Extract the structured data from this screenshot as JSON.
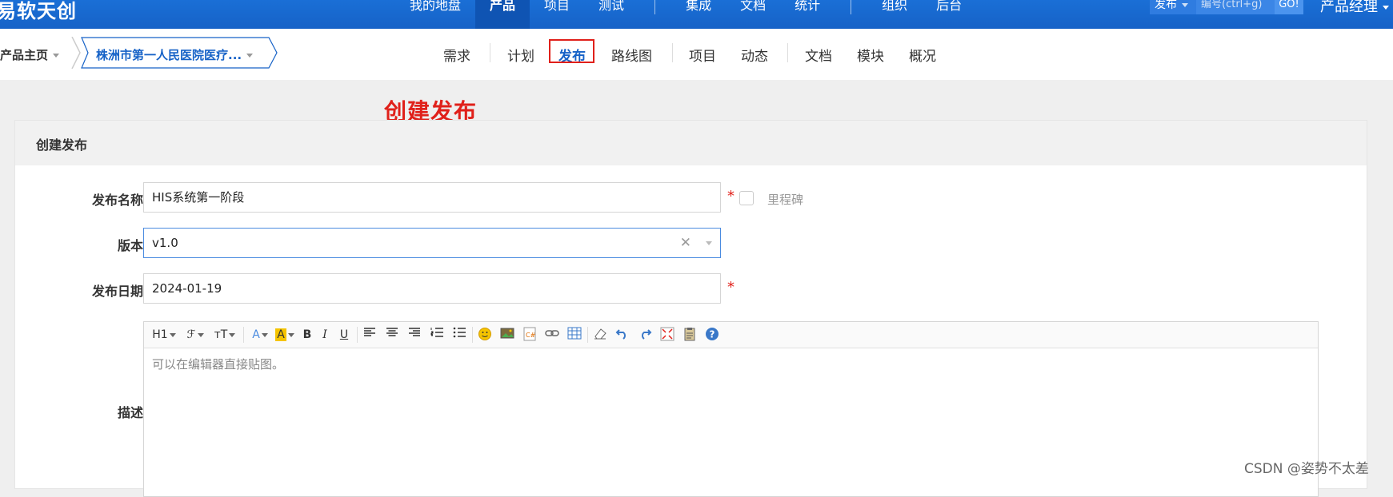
{
  "brand": "易软天创",
  "main_nav": [
    "我的地盘",
    "产品",
    "项目",
    "测试",
    "集成",
    "文档",
    "统计",
    "组织",
    "后台"
  ],
  "search": {
    "type_label": "发布",
    "placeholder": "编号(ctrl+g)",
    "go_label": "GO!"
  },
  "user_label": "产品经理",
  "breadcrumb": {
    "home": "产品主页",
    "product": "株洲市第一人民医院医疗..."
  },
  "sub_nav": [
    "需求",
    "计划",
    "发布",
    "路线图",
    "项目",
    "动态",
    "文档",
    "模块",
    "概况"
  ],
  "sub_nav_active": "发布",
  "annotation": "创建发布",
  "panel": {
    "title": "创建发布"
  },
  "form": {
    "name_label": "发布名称",
    "name_value": "HIS系统第一阶段",
    "milestone_label": "里程碑",
    "version_label": "版本",
    "version_value": "v1.0",
    "date_label": "发布日期",
    "date_value": "2024-01-19",
    "desc_label": "描述",
    "desc_placeholder": "可以在编辑器直接贴图。",
    "required_mark": "*"
  },
  "toolbar_text": {
    "h1": "H1",
    "font": "ℱ",
    "size": "ᴛT",
    "bold": "B",
    "italic": "I",
    "underline": "U",
    "font_color": "A",
    "bg_color": "A"
  },
  "colors": {
    "topbar": "#1662c7",
    "accent": "#1662c7",
    "highlight": "#e0201a"
  },
  "watermark": "CSDN @姿势不太差"
}
